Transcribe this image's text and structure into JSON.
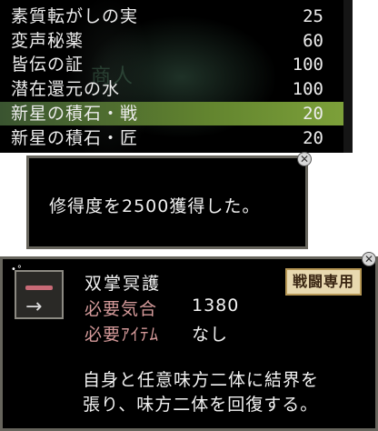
{
  "shop_list": {
    "items": [
      {
        "name": "素質転がしの実",
        "qty": "25"
      },
      {
        "name": "変声秘薬",
        "qty": "60"
      },
      {
        "name": "皆伝の証",
        "qty": "100"
      },
      {
        "name": "潜在還元の水",
        "qty": "100"
      },
      {
        "name": "新星の積石・戦",
        "qty": "20"
      },
      {
        "name": "新星の積石・匠",
        "qty": "20"
      }
    ],
    "selected_index": 4,
    "background_text": "商人",
    "selected_color": "#63852f"
  },
  "message": {
    "text": "修得度を2500獲得した。"
  },
  "skill": {
    "name": "双掌冥護",
    "badge": "戦闘専用",
    "requirements": [
      {
        "label": "必要気合",
        "value": "1380"
      },
      {
        "label": "必要ｱｲﾃﾑ",
        "value": "なし"
      }
    ],
    "description_lines": [
      "自身と任意味方二体に結界を",
      "張り、味方二体を回復する。"
    ],
    "icon": "shield-arrow-icon"
  },
  "close_glyph": "✕"
}
